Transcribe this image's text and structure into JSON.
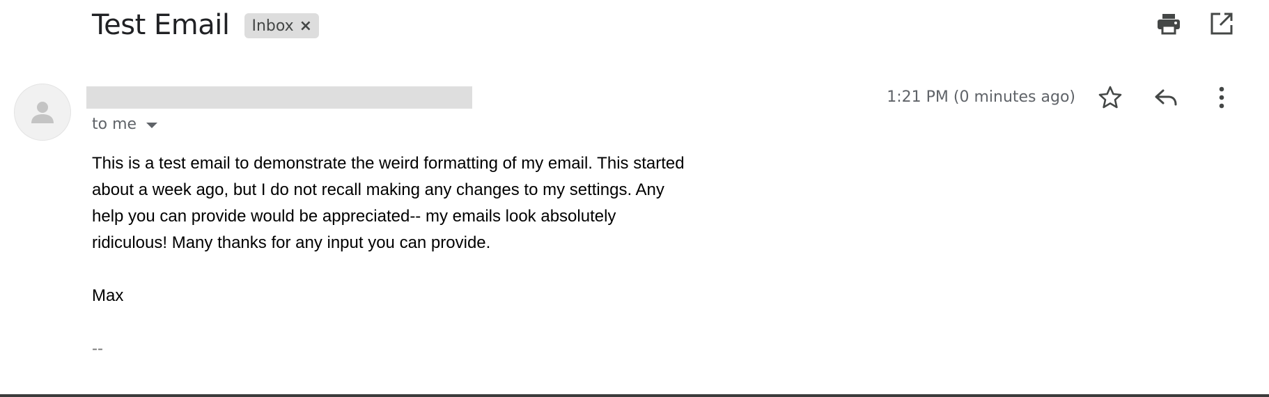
{
  "subject": "Test Email",
  "label_chip": {
    "text": "Inbox",
    "remove": "×"
  },
  "toolbar": {
    "print_icon": "print-icon",
    "open_new_window_icon": "open-in-new-window-icon"
  },
  "message": {
    "recipient": "to me",
    "timestamp": "1:21 PM (0 minutes ago)",
    "actions": [
      "star-icon",
      "reply-icon",
      "more-vert-icon"
    ],
    "body_paragraph": "This is a test email to demonstrate the weird formatting of my email. This started about a week ago, but I do not recall making any changes to my settings. Any help you can provide would be appreciated-- my emails look absolutely ridiculous! Many thanks for any input you can provide.",
    "sign_off": "Max",
    "signature_dashes": "--"
  },
  "colors": {
    "text_primary": "#202124",
    "text_secondary": "#5f6368",
    "chip_bg": "#dddddd",
    "redaction": "#dedede"
  }
}
